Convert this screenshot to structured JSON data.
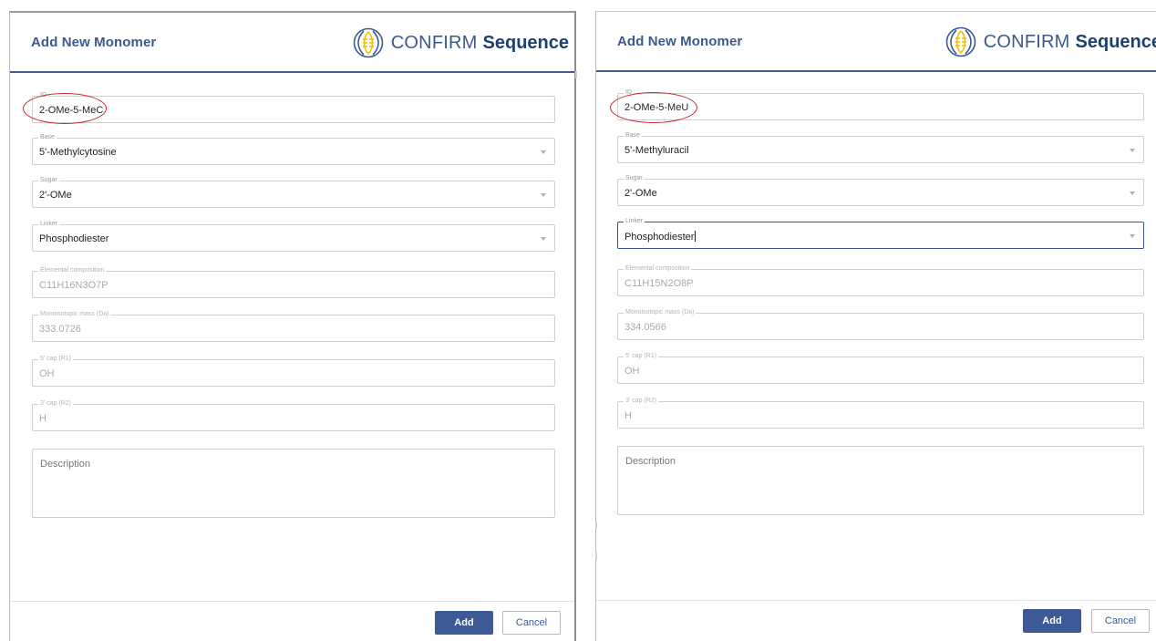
{
  "logo": {
    "light": "CONFIRM",
    "bold": "Sequence",
    "icon": "confirm-logo-icon"
  },
  "panels": [
    {
      "title": "Add New Monomer",
      "id": {
        "label": "ID",
        "value": "2-OMe-5-MeC"
      },
      "base": {
        "label": "Base",
        "value": "5'-Methylcytosine"
      },
      "sugar": {
        "label": "Sugar",
        "value": "2'-OMe"
      },
      "linker": {
        "label": "Linker",
        "value": "Phosphodiester"
      },
      "elemental": {
        "label": "Elemental composition",
        "value": "C11H16N3O7P"
      },
      "mass": {
        "label": "Monoisotopic mass (Da)",
        "value": "333.0726"
      },
      "cap5": {
        "label": "5' cap (R1)",
        "value": "OH"
      },
      "cap3": {
        "label": "3' cap (R2)",
        "value": "H"
      },
      "description": {
        "placeholder": "Description"
      },
      "buttons": {
        "add": "Add",
        "cancel": "Cancel"
      }
    },
    {
      "title": "Add New Monomer",
      "id": {
        "label": "ID",
        "value": "2-OMe-5-MeU"
      },
      "base": {
        "label": "Base",
        "value": "5'-Methyluracil"
      },
      "sugar": {
        "label": "Sugar",
        "value": "2'-OMe"
      },
      "linker": {
        "label": "Linker",
        "value": "Phosphodiester"
      },
      "elemental": {
        "label": "Elemental composition",
        "value": "C11H15N2O8P"
      },
      "mass": {
        "label": "Monoisotopic mass (Da)",
        "value": "334.0566"
      },
      "cap5": {
        "label": "5' cap (R1)",
        "value": "OH"
      },
      "cap3": {
        "label": "3' cap (R2)",
        "value": "H"
      },
      "description": {
        "placeholder": "Description"
      },
      "buttons": {
        "add": "Add",
        "cancel": "Cancel"
      }
    }
  ],
  "colors": {
    "accent": "#3c5a8f",
    "brand_dark": "#1e3f74",
    "logo_yellow": "#f2c200",
    "highlight_ring": "#c8262c",
    "add_button": "#3d5a96"
  }
}
